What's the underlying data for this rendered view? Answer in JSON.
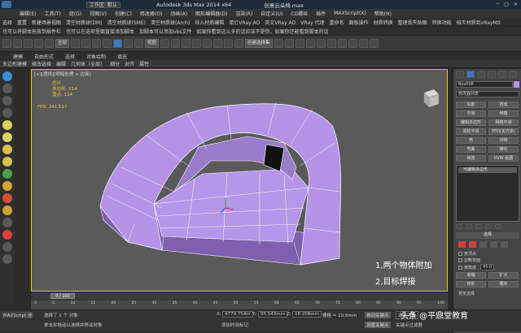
{
  "titlebar": {
    "workspace": "工作区: 默认",
    "app_title": "Autodesk 3ds Max  2014 x64",
    "filename": "创意云朵椅.max"
  },
  "menu": [
    "编辑(E)",
    "工具(T)",
    "组(G)",
    "视图(V)",
    "创建(C)",
    "修改器(O)",
    "动画(A)",
    "图形编辑器(D)",
    "渲染(R)",
    "自定义(U)",
    "CG螺丝",
    "插件",
    "MAXScript(X)",
    "帮助(H)"
  ],
  "plugins_row1": [
    "选择",
    "重置",
    "新建场景视图",
    "清空材质球(DM)",
    "清空材质球(SME)",
    "清空材质球(Arch)",
    "导入材质编辑",
    "单灯VRay AO",
    "英文VRay AO",
    "VRay 代理",
    "重命名",
    "面板操作",
    "材质转换",
    "整理丢失贴图",
    "转换功能",
    "掐灭材质到vRayMtl"
  ],
  "plugins_row2": [
    "也可以将脚本拖放到插件栏",
    "也可以在选项里面直接添加脚本",
    "加脚本可以添加vbs文件",
    "如果你看到这么多的话应该不是你，如果你还能看到脚本的话"
  ],
  "toolbar": {
    "selection_filter": "全部",
    "view_dropdown": "视图",
    "selection_set": "创建选择集"
  },
  "ribbon": {
    "tabs": [
      "建模",
      "自由形式",
      "选择",
      "对象绘制",
      "填充"
    ],
    "sub": [
      "多边形建模",
      "修改选择",
      "编辑",
      "几何体（全部）",
      "细分",
      "对齐",
      "属性"
    ]
  },
  "viewport": {
    "label": "[+][透视][明暗处理 + 边面]",
    "stats_title": "总计",
    "polys_label": "多边形:",
    "polys_value": "114",
    "verts_label": "顶点:",
    "verts_value": "114",
    "fps_label": "FPS:",
    "fps_value": "241.517",
    "annotation_1": "1,两个物体附加",
    "annotation_2": "2,目标焊接"
  },
  "right_panel": {
    "object_name": "Box006",
    "modifier_list": "修改器列表",
    "buttons": [
      "车削",
      "挤出",
      "平滑",
      "倒角",
      "编辑多边形",
      "网格平滑",
      "涡轮平滑",
      "FFD(长方体)",
      "壳",
      "对称",
      "弯曲",
      "锥化",
      "噪波",
      "UVW 贴图"
    ],
    "stack_item": "可编辑多边形",
    "rollout_title": "选择",
    "checkbox_1": "按顶点",
    "checkbox_2": "忽略背面",
    "checkbox_3": "按角度",
    "angle_value": "45.0",
    "shrink": "收缩",
    "grow": "扩大",
    "ring": "环形",
    "loop": "循环",
    "preview_selection": "预览选择"
  },
  "timeline": {
    "frame": "0 / 100"
  },
  "ruler_ticks": [
    "0",
    "5",
    "10",
    "15",
    "20",
    "25",
    "30",
    "35",
    "40",
    "45",
    "50",
    "55",
    "60",
    "65",
    "70",
    "75",
    "80",
    "85",
    "90",
    "95",
    "100"
  ],
  "status": {
    "script_label": "MAXScript 迷",
    "selected": "选择了 1 个 对象",
    "hint": "单击并拖动以选择并移动对象",
    "x_label": "X:",
    "x_value": "4779.754m",
    "y_label": "Y:",
    "y_value": "95.543mm",
    "z_label": "Z:",
    "z_value": "18.208mm",
    "grid": "栅格 = 10.0mm",
    "auto_key": "自动关键点",
    "selected_obj": "选定对象",
    "set_key": "设置关键点",
    "key_filter": "关键点过滤器",
    "add_time_tag": "添加时间标记"
  },
  "watermark": "头条 @平鼎堂教育",
  "colors": {
    "mesh": "#b593e6",
    "mesh_dark": "#8e6bbf",
    "viewport_bg": "#5a5a5a",
    "viewport_border": "#d8d000",
    "stats": "#e8d040"
  }
}
